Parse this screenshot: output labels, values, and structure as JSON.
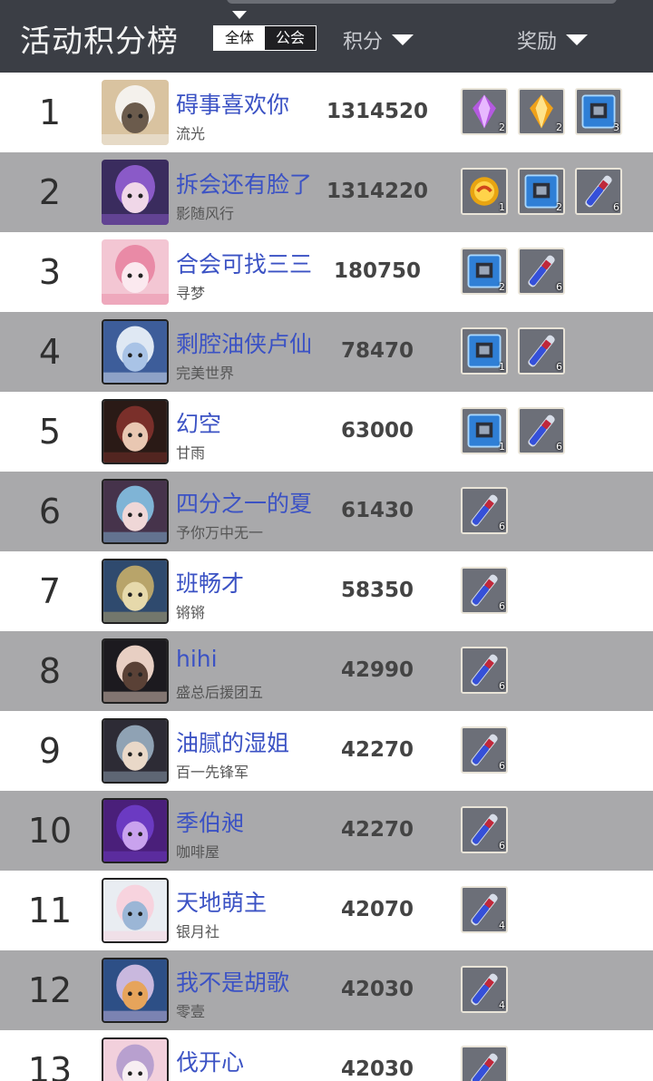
{
  "header": {
    "title": "活动积分榜",
    "toggle": {
      "all": "全体",
      "guild": "公会"
    },
    "score_col": "积分",
    "reward_col": "奖励"
  },
  "colors": {
    "name": "#3b52c4",
    "row_light": "#ffffff",
    "row_dark": "#a9a9ab",
    "header_bg": "#3b3e45"
  },
  "rows": [
    {
      "rank": "1",
      "name": "碍事喜欢你",
      "guild": "流光",
      "score": "1314520",
      "avatar": "cat-avatar",
      "rewards": [
        {
          "icon": "purple-crystal-icon",
          "count": "2"
        },
        {
          "icon": "gold-crystal-icon",
          "count": "2"
        },
        {
          "icon": "blue-chip-icon",
          "count": "3"
        }
      ]
    },
    {
      "rank": "2",
      "name": "拆会还有脸了",
      "guild": "影随风行",
      "score": "1314220",
      "avatar": "purple-hair-avatar",
      "rewards": [
        {
          "icon": "gold-orb-icon",
          "count": "1"
        },
        {
          "icon": "blue-chip-icon",
          "count": "2"
        },
        {
          "icon": "potion-vial-icon",
          "count": "6"
        }
      ]
    },
    {
      "rank": "3",
      "name": "合会可找三三",
      "guild": "寻梦",
      "score": "180750",
      "avatar": "pink-hair-avatar",
      "rewards": [
        {
          "icon": "blue-chip-icon",
          "count": "2"
        },
        {
          "icon": "potion-vial-icon",
          "count": "6"
        }
      ]
    },
    {
      "rank": "4",
      "name": "剩腔油侠卢仙",
      "guild": "完美世界",
      "score": "78470",
      "avatar": "white-hair-avatar",
      "rewards": [
        {
          "icon": "blue-chip-icon",
          "count": "1"
        },
        {
          "icon": "potion-vial-icon",
          "count": "6"
        }
      ]
    },
    {
      "rank": "5",
      "name": "幻空",
      "guild": "甘雨",
      "score": "63000",
      "avatar": "fox-ears-avatar",
      "rewards": [
        {
          "icon": "blue-chip-icon",
          "count": "1"
        },
        {
          "icon": "potion-vial-icon",
          "count": "6"
        }
      ]
    },
    {
      "rank": "6",
      "name": "四分之一的夏",
      "guild": "予你万中无一",
      "score": "61430",
      "avatar": "brown-hair-avatar",
      "rewards": [
        {
          "icon": "potion-vial-icon",
          "count": "6"
        }
      ]
    },
    {
      "rank": "7",
      "name": "班畅才",
      "guild": "锵锵",
      "score": "58350",
      "avatar": "ornate-avatar",
      "rewards": [
        {
          "icon": "potion-vial-icon",
          "count": "6"
        }
      ]
    },
    {
      "rank": "8",
      "name": "hihi",
      "guild": "盛总后援团五",
      "score": "42990",
      "avatar": "dark-hair-avatar",
      "rewards": [
        {
          "icon": "potion-vial-icon",
          "count": "6"
        }
      ]
    },
    {
      "rank": "9",
      "name": "油腻的湿姐",
      "guild": "百一先锋军",
      "score": "42270",
      "avatar": "bangs-avatar",
      "rewards": [
        {
          "icon": "potion-vial-icon",
          "count": "6"
        }
      ]
    },
    {
      "rank": "10",
      "name": "季伯昶",
      "guild": "咖啡屋",
      "score": "42270",
      "avatar": "violet-avatar",
      "rewards": [
        {
          "icon": "potion-vial-icon",
          "count": "6"
        }
      ]
    },
    {
      "rank": "11",
      "name": "天地萌主",
      "guild": "银月社",
      "score": "42070",
      "avatar": "silver-hair-avatar",
      "rewards": [
        {
          "icon": "potion-vial-icon",
          "count": "4"
        }
      ]
    },
    {
      "rank": "12",
      "name": "我不是胡歌",
      "guild": "零壹",
      "score": "42030",
      "avatar": "armor-avatar",
      "rewards": [
        {
          "icon": "potion-vial-icon",
          "count": "4"
        }
      ]
    },
    {
      "rank": "13",
      "name": "伐开心",
      "guild": "",
      "score": "42030",
      "avatar": "pink-cat-avatar",
      "rewards": [
        {
          "icon": "potion-vial-icon",
          "count": ""
        }
      ]
    }
  ]
}
